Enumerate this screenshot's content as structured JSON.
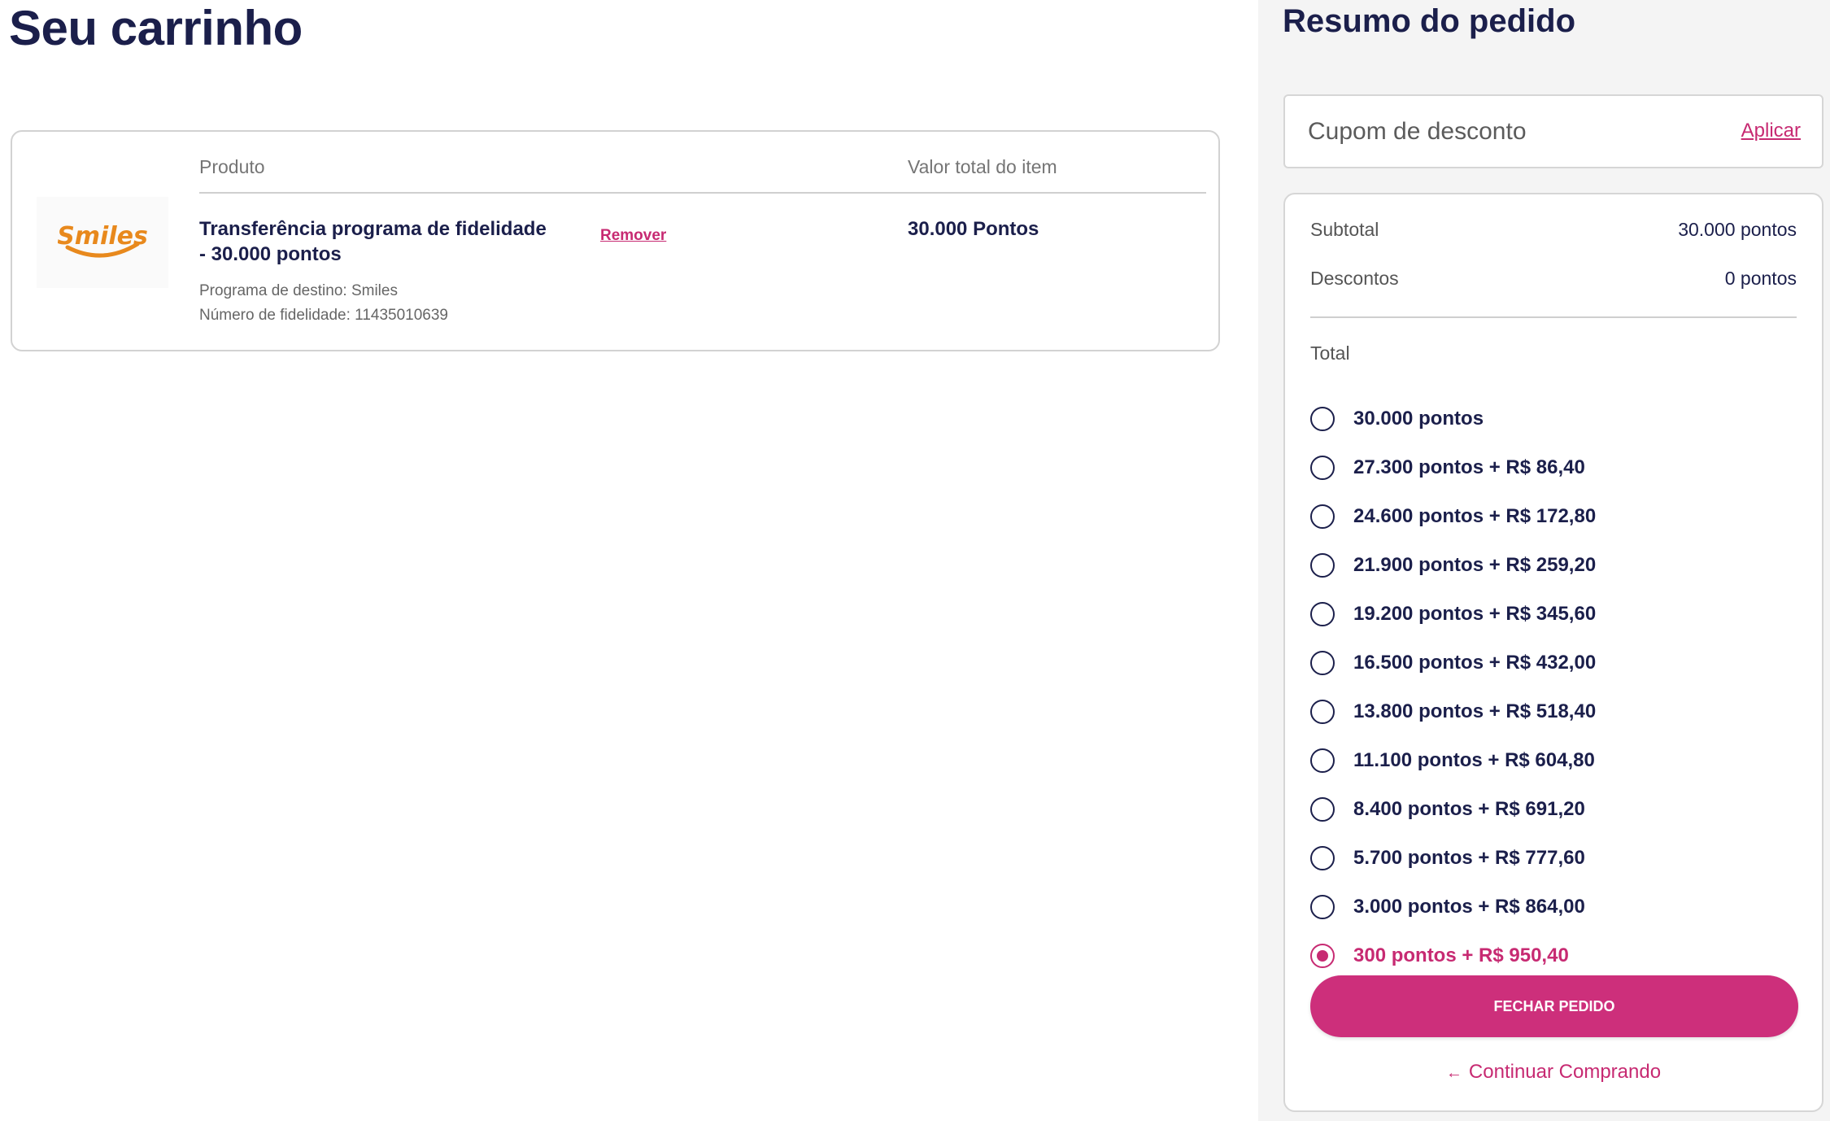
{
  "cart": {
    "title": "Seu carrinho",
    "headers": {
      "product": "Produto",
      "total_value": "Valor total do item"
    },
    "item": {
      "logo_text": "Smiles",
      "name": "Transferência programa de fidelidade - 30.000 pontos",
      "remove_label": "Remover",
      "value": "30.000 Pontos",
      "destination": "Programa de destino: Smiles",
      "loyalty_number": "Número de fidelidade: 11435010639"
    }
  },
  "summary": {
    "title": "Resumo do pedido",
    "coupon": {
      "placeholder": "Cupom de desconto",
      "apply_label": "Aplicar"
    },
    "subtotal_label": "Subtotal",
    "subtotal_value": "30.000 pontos",
    "discounts_label": "Descontos",
    "discounts_value": "0 pontos",
    "total_label": "Total",
    "payment_options": [
      {
        "label": "30.000 pontos",
        "selected": false
      },
      {
        "label": "27.300 pontos + R$ 86,40",
        "selected": false
      },
      {
        "label": "24.600 pontos + R$ 172,80",
        "selected": false
      },
      {
        "label": "21.900 pontos + R$ 259,20",
        "selected": false
      },
      {
        "label": "19.200 pontos + R$ 345,60",
        "selected": false
      },
      {
        "label": "16.500 pontos + R$ 432,00",
        "selected": false
      },
      {
        "label": "13.800 pontos + R$ 518,40",
        "selected": false
      },
      {
        "label": "11.100 pontos + R$ 604,80",
        "selected": false
      },
      {
        "label": "8.400 pontos + R$ 691,20",
        "selected": false
      },
      {
        "label": "5.700 pontos + R$ 777,60",
        "selected": false
      },
      {
        "label": "3.000 pontos + R$ 864,00",
        "selected": false
      },
      {
        "label": "300 pontos + R$ 950,40",
        "selected": true
      }
    ],
    "checkout_label": "FECHAR PEDIDO",
    "continue_label": "Continuar Comprando"
  },
  "colors": {
    "brand_navy": "#1b1f4b",
    "accent_pink": "#cd2f7b",
    "smiles_orange": "#e8891d"
  },
  "icons": {
    "continue": "arrow-left-icon",
    "logo": "smiles-logo"
  }
}
